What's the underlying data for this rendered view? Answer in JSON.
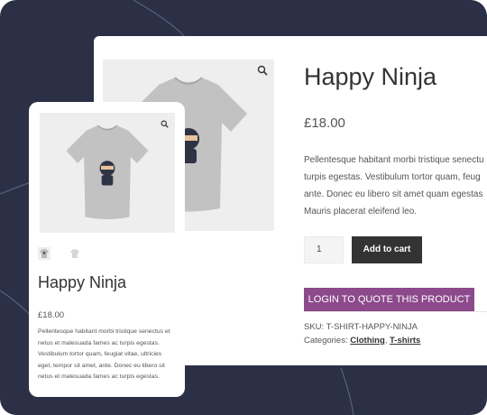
{
  "colors": {
    "background": "#2b3046",
    "card": "#ffffff",
    "image_bg": "#eeeeee",
    "tshirt": "#bdbdbd",
    "button_dark": "#333333",
    "quote_button": "#8c4a8c"
  },
  "desktop": {
    "zoom_icon": "magnifier-icon",
    "title": "Happy Ninja",
    "price": "£18.00",
    "description_lines": [
      "Pellentesque habitant morbi tristique senectu",
      "turpis egestas. Vestibulum tortor quam, feug",
      "ante. Donec eu libero sit amet quam egestas",
      "Mauris placerat eleifend leo."
    ],
    "quantity": "1",
    "add_to_cart_label": "Add to cart",
    "quote_label": "LOGIN TO QUOTE THIS PRODUCT",
    "sku_label": "SKU:",
    "sku_value": "T-SHIRT-HAPPY-NINJA",
    "categories_label": "Categories:",
    "categories": [
      "Clothing",
      "T-shirts"
    ],
    "categories_separator": ","
  },
  "mobile": {
    "zoom_icon": "magnifier-icon",
    "title": "Happy Ninja",
    "price": "£18.00",
    "description_lines": [
      "Pellentesque habitant morbi tristique senectus et",
      "netus et malesuada fames ac turpis egestas.",
      "Vestibulum tortor quam, feugiat vitae, ultricies",
      "eget, tempor sit amet, ante. Donec eu libero sit",
      "netus et malesuada fames ac turpis egestas."
    ]
  }
}
